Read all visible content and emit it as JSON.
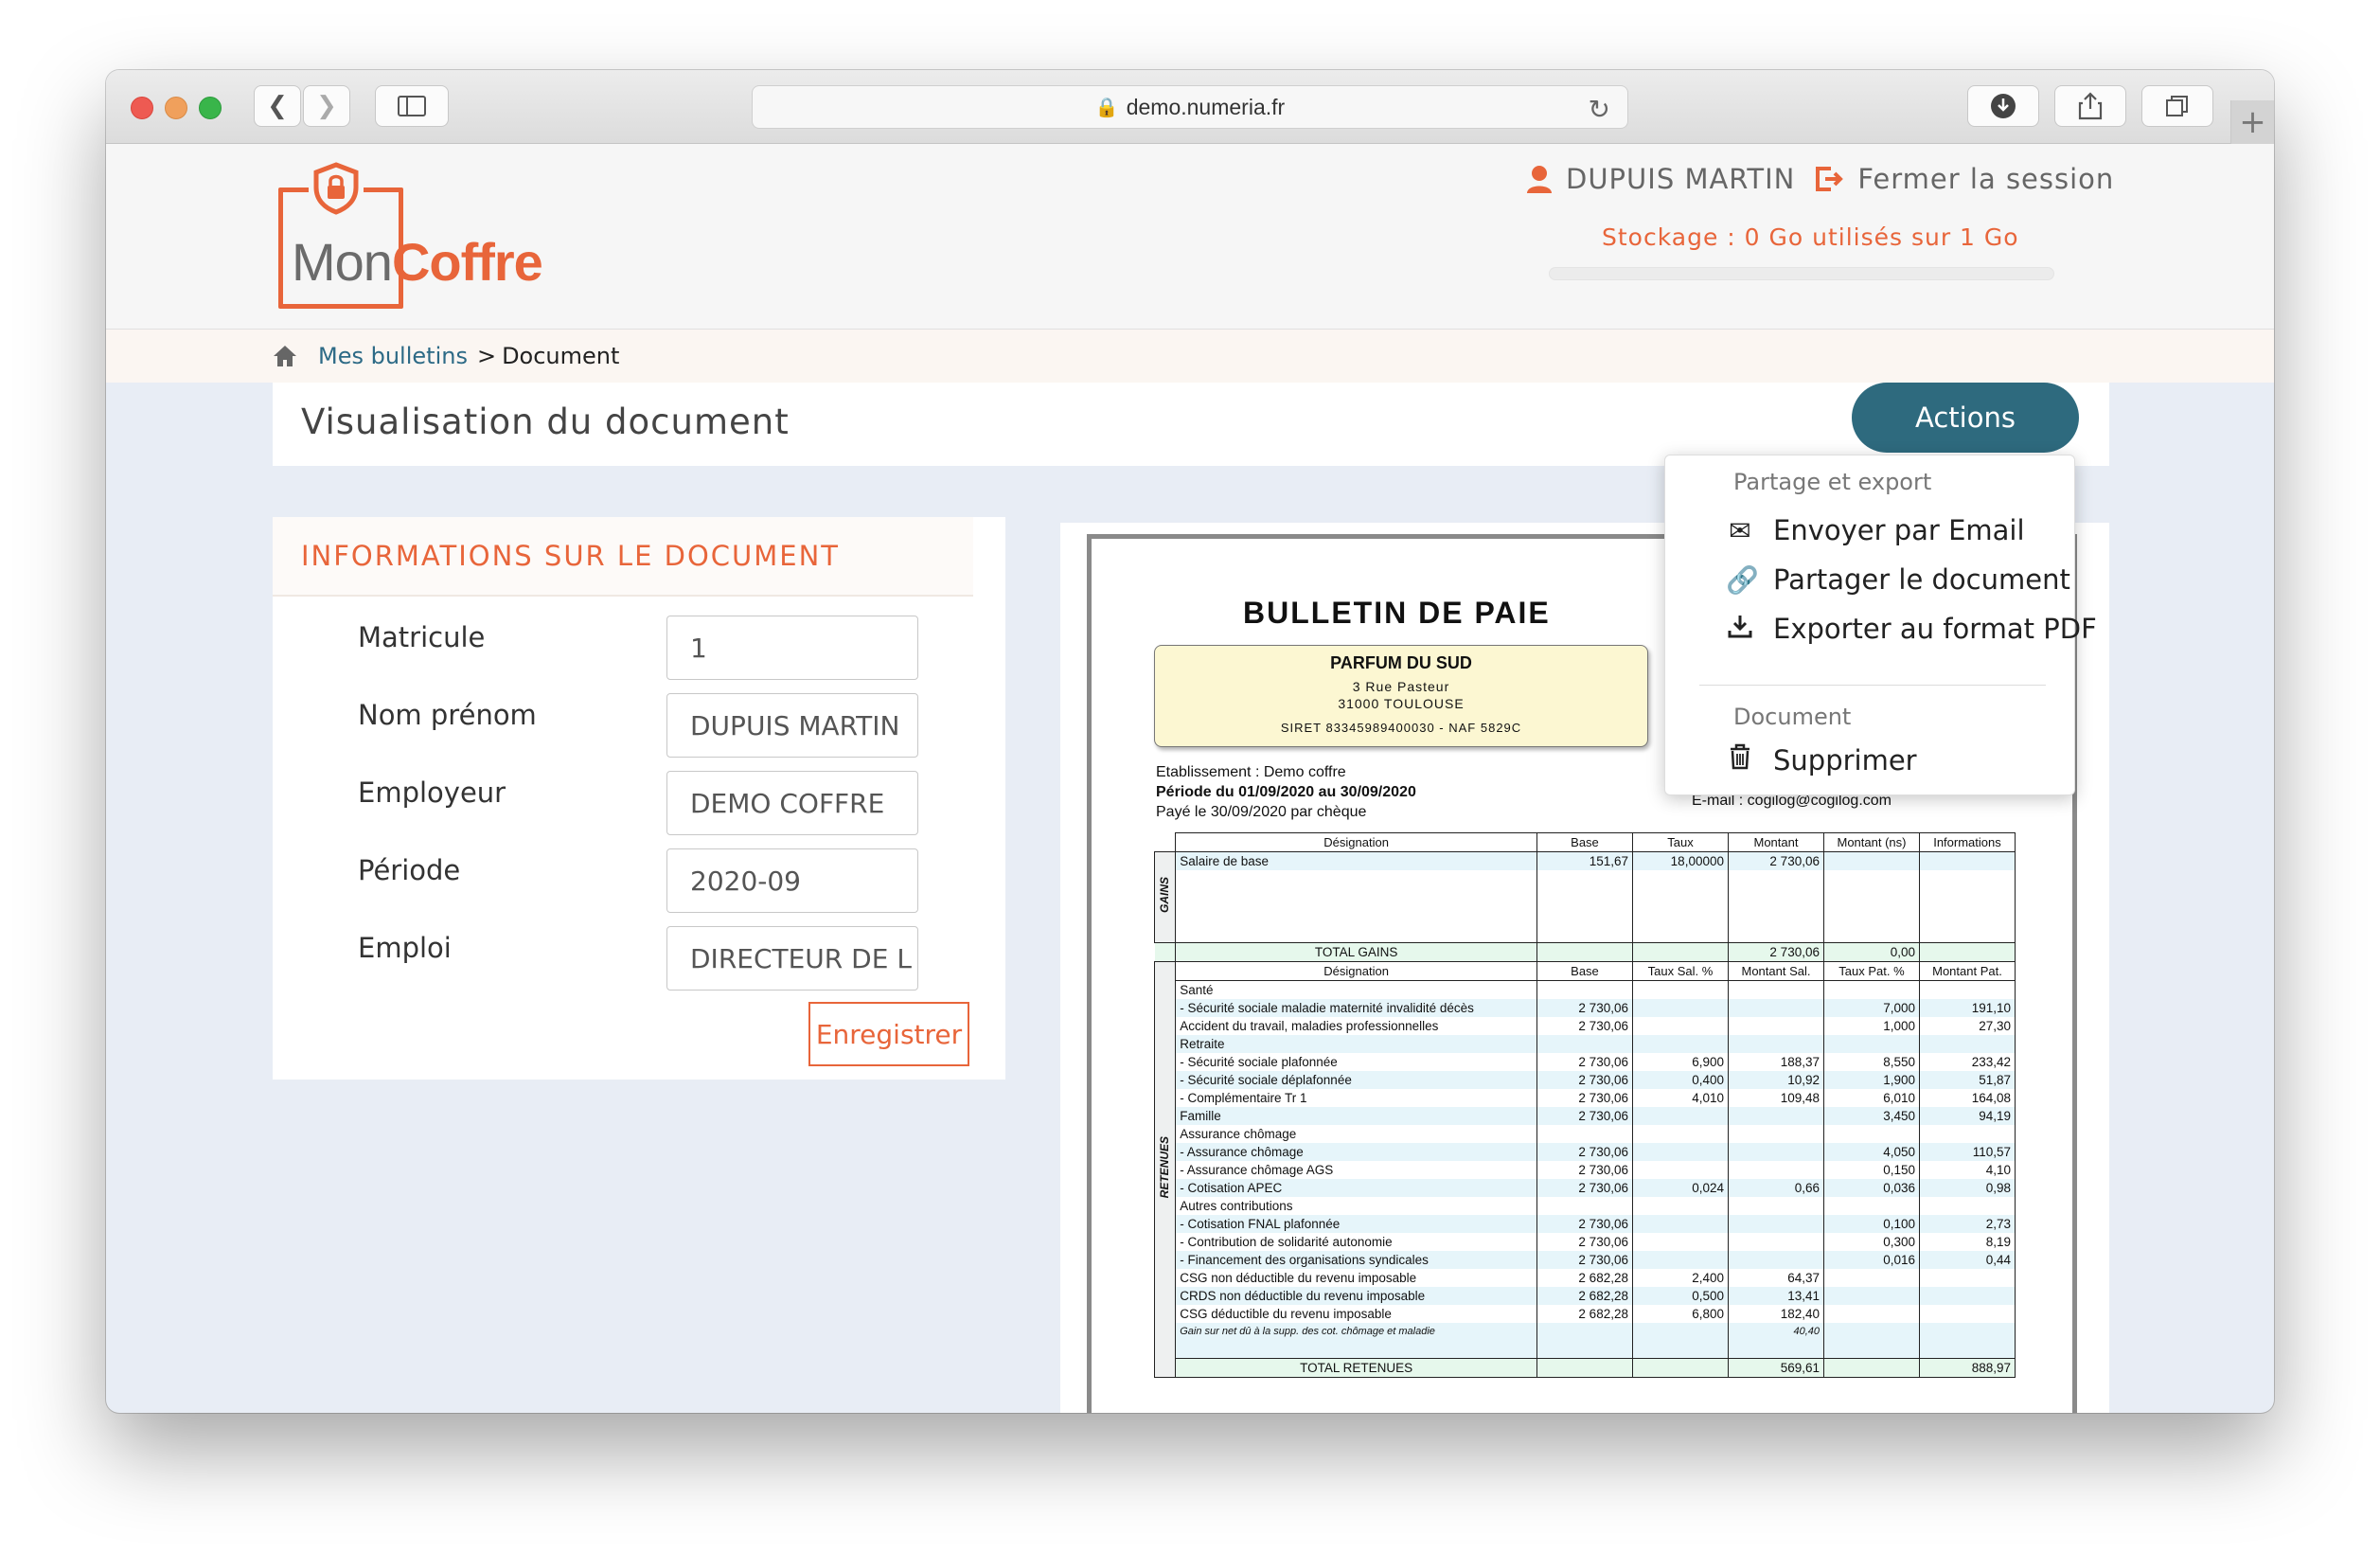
{
  "browser": {
    "url": "demo.numeria.fr"
  },
  "brand": {
    "logo_part1": "Mon",
    "logo_part2": "Coffre",
    "accent_color": "#e8653a",
    "primary_color": "#2e6a7e"
  },
  "header": {
    "user_name": "DUPUIS MARTIN",
    "logout_label": "Fermer la session",
    "storage_text": "Stockage : 0 Go utilisés sur 1 Go",
    "storage_used_fraction": 0
  },
  "breadcrumb": {
    "parent": "Mes bulletins",
    "separator": ">",
    "current": "Document"
  },
  "page": {
    "title": "Visualisation du document",
    "actions_label": "Actions"
  },
  "info": {
    "heading": "INFORMATIONS SUR LE DOCUMENT",
    "fields": [
      {
        "label": "Matricule",
        "value": "1"
      },
      {
        "label": "Nom prénom",
        "value": "DUPUIS MARTIN"
      },
      {
        "label": "Employeur",
        "value": "DEMO COFFRE"
      },
      {
        "label": "Période",
        "value": "2020-09"
      },
      {
        "label": "Emploi",
        "value": "DIRECTEUR DE L"
      }
    ],
    "save_label": "Enregistrer"
  },
  "menu": {
    "section1": "Partage et export",
    "email": "Envoyer par Email",
    "share": "Partager le document",
    "export": "Exporter au format PDF",
    "section2": "Document",
    "delete": "Supprimer"
  },
  "doc": {
    "title": "BULLETIN DE PAIE",
    "company": "PARFUM DU SUD",
    "address1": "3 Rue Pasteur",
    "address2": "31000 TOULOUSE",
    "siret": "SIRET 83345989400030 - NAF 5829C",
    "etab": "Etablissement : Demo coffre",
    "periode": "Période du 01/09/2020 au 30/09/2020",
    "paye": "Payé le 30/09/2020 par chèque",
    "email": "E-mail : cogilog@cogilog.com",
    "gains_label": "GAINS",
    "retenues_label": "RETENUES",
    "gains_header": [
      "Désignation",
      "Base",
      "Taux",
      "Montant",
      "Montant (ns)",
      "Informations"
    ],
    "gains_rows": [
      [
        "Salaire de base",
        "151,67",
        "18,00000",
        "2 730,06",
        "",
        ""
      ]
    ],
    "total_gains": [
      "TOTAL GAINS",
      "",
      "",
      "2 730,06",
      "0,00",
      ""
    ],
    "ret_header": [
      "Désignation",
      "Base",
      "Taux Sal. %",
      "Montant Sal.",
      "Taux Pat. %",
      "Montant Pat."
    ],
    "ret_rows": [
      [
        "Santé",
        "",
        "",
        "",
        "",
        ""
      ],
      [
        "- Sécurité sociale maladie maternité invalidité décès",
        "2 730,06",
        "",
        "",
        "7,000",
        "191,10"
      ],
      [
        "Accident du travail, maladies professionnelles",
        "2 730,06",
        "",
        "",
        "1,000",
        "27,30"
      ],
      [
        "Retraite",
        "",
        "",
        "",
        "",
        ""
      ],
      [
        "- Sécurité sociale plafonnée",
        "2 730,06",
        "6,900",
        "188,37",
        "8,550",
        "233,42"
      ],
      [
        "- Sécurité sociale déplafonnée",
        "2 730,06",
        "0,400",
        "10,92",
        "1,900",
        "51,87"
      ],
      [
        "- Complémentaire Tr 1",
        "2 730,06",
        "4,010",
        "109,48",
        "6,010",
        "164,08"
      ],
      [
        "Famille",
        "2 730,06",
        "",
        "",
        "3,450",
        "94,19"
      ],
      [
        "Assurance chômage",
        "",
        "",
        "",
        "",
        ""
      ],
      [
        "- Assurance chômage",
        "2 730,06",
        "",
        "",
        "4,050",
        "110,57"
      ],
      [
        "- Assurance chômage AGS",
        "2 730,06",
        "",
        "",
        "0,150",
        "4,10"
      ],
      [
        "- Cotisation APEC",
        "2 730,06",
        "0,024",
        "0,66",
        "0,036",
        "0,98"
      ],
      [
        "Autres contributions",
        "",
        "",
        "",
        "",
        ""
      ],
      [
        "- Cotisation FNAL plafonnée",
        "2 730,06",
        "",
        "",
        "0,100",
        "2,73"
      ],
      [
        "- Contribution de solidarité autonomie",
        "2 730,06",
        "",
        "",
        "0,300",
        "8,19"
      ],
      [
        "- Financement des organisations syndicales",
        "2 730,06",
        "",
        "",
        "0,016",
        "0,44"
      ],
      [
        "CSG non déductible du revenu imposable",
        "2 682,28",
        "2,400",
        "64,37",
        "",
        ""
      ],
      [
        "CRDS non déductible du revenu imposable",
        "2 682,28",
        "0,500",
        "13,41",
        "",
        ""
      ],
      [
        "CSG déductible du revenu imposable",
        "2 682,28",
        "6,800",
        "182,40",
        "",
        ""
      ],
      [
        "Gain sur net dû à la supp. des cot. chômage et maladie",
        "",
        "",
        "40,40",
        "",
        ""
      ]
    ],
    "total_retenues": [
      "TOTAL RETENUES",
      "",
      "",
      "569,61",
      "",
      "888,97"
    ]
  }
}
